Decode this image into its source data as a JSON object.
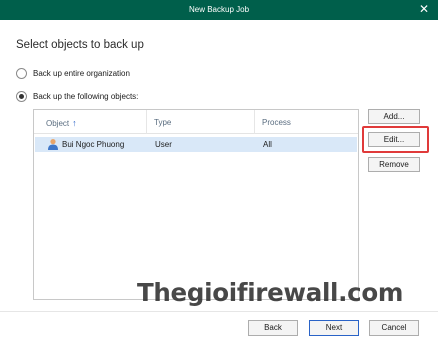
{
  "window": {
    "title": "New Backup Job",
    "close_glyph": "✕"
  },
  "heading": "Select objects to back up",
  "options": [
    {
      "label": "Back up entire organization",
      "selected": false
    },
    {
      "label": "Back up the following objects:",
      "selected": true
    }
  ],
  "grid": {
    "columns": [
      {
        "label": "Object",
        "sort": "ascending",
        "sort_glyph": "↑"
      },
      {
        "label": "Type"
      },
      {
        "label": "Process"
      }
    ],
    "rows": [
      {
        "icon": "user-icon",
        "object": "Bui Ngoc Phuong",
        "type": "User",
        "process": "All",
        "selected": true
      }
    ]
  },
  "side_buttons": {
    "add": "Add...",
    "edit": "Edit...",
    "remove": "Remove"
  },
  "footer": {
    "back": "Back",
    "next": "Next",
    "cancel": "Cancel"
  },
  "watermark": "Thegioifirewall.com",
  "colors": {
    "title_bar": "#005f4b",
    "selected_row": "#d9e8f8",
    "highlight_box": "#e03a3a",
    "sort_arrow": "#2a63c7"
  }
}
